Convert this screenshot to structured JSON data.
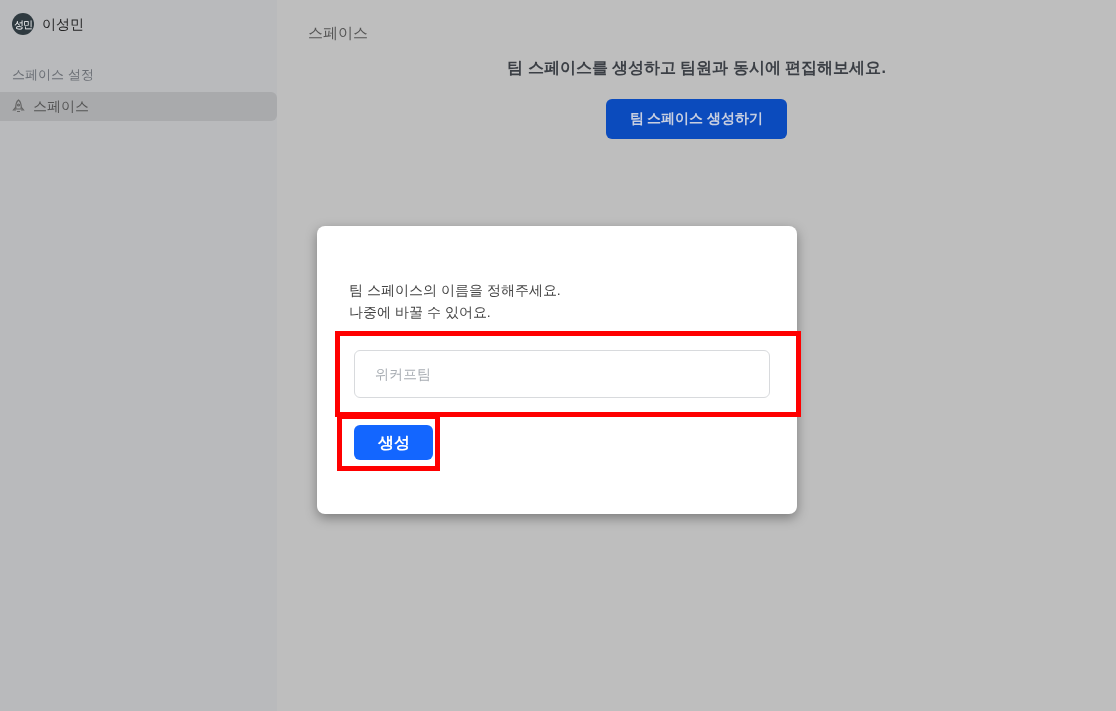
{
  "sidebar": {
    "user": {
      "avatar": "성민",
      "name": "이성민"
    },
    "section_title": "스페이스 설정",
    "items": [
      {
        "label": "스페이스",
        "selected": true
      }
    ]
  },
  "main": {
    "title": "스페이스",
    "message": "팀 스페이스를 생성하고 팀원과 동시에 편집해보세요.",
    "create_button": "팀 스페이스 생성하기"
  },
  "dialog": {
    "lines": [
      "팀 스페이스의 이름을 정해주세요.",
      "나중에 바꿀 수 있어요."
    ],
    "name_field": {
      "placeholder": "위커프팀",
      "highlighted": true
    },
    "submit_button": {
      "label": "생성",
      "highlighted": true
    }
  }
}
